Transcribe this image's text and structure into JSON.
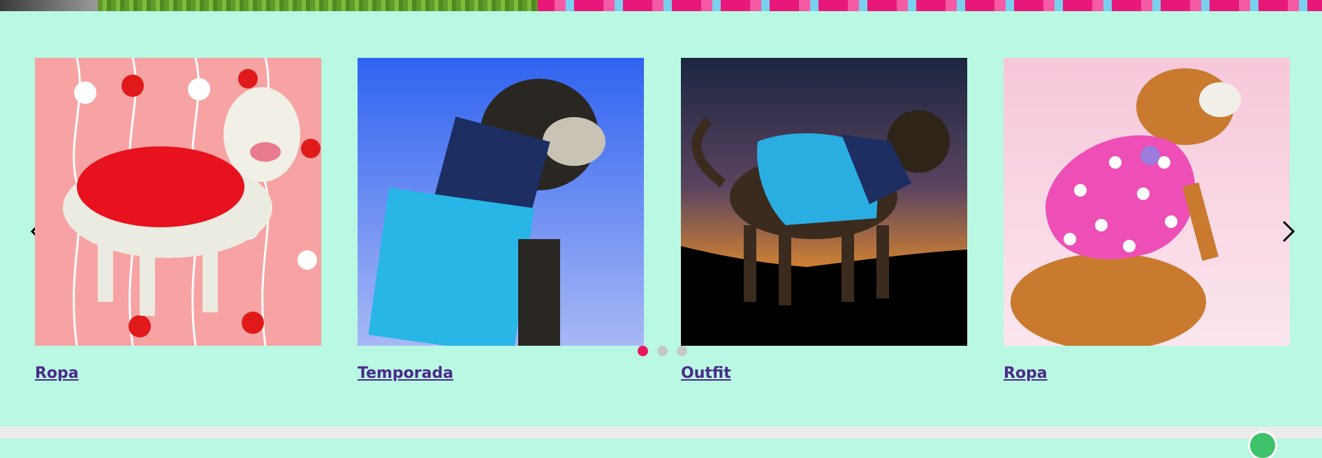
{
  "carousel": {
    "cards": [
      {
        "label": "Ropa",
        "image": "dog-red-heart-dress"
      },
      {
        "label": "Temporada",
        "image": "dog-blue-puffer-coat"
      },
      {
        "label": "Outfit",
        "image": "dog-sunset-puffer-vest"
      },
      {
        "label": "Ropa",
        "image": "dog-pink-heart-shirt"
      }
    ],
    "dots": {
      "count": 3,
      "active_index": 0
    },
    "prev_icon": "chevron-left-icon",
    "next_icon": "chevron-right-icon"
  },
  "colors": {
    "background": "#b9f8e2",
    "link": "#4a2a8a",
    "dot_active": "#e8175e",
    "dot_inactive": "#c4c9c6"
  }
}
